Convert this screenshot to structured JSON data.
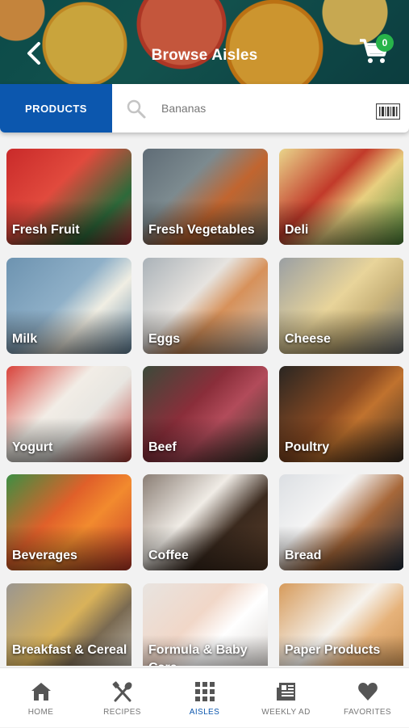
{
  "header": {
    "title": "Browse Aisles",
    "cart_count": "0"
  },
  "search": {
    "tab_label": "PRODUCTS",
    "value": "Bananas"
  },
  "aisles": [
    {
      "label": "Fresh Fruit",
      "bg": "linear-gradient(135deg,#c92a2a,#e14a3d 40%,#2d6a3a 75%,#b8323a)"
    },
    {
      "label": "Fresh Vegetables",
      "bg": "linear-gradient(135deg,#5f6c76,#7c8a8f 35%,#c1652f 60%,#6a6a5a)"
    },
    {
      "label": "Deli",
      "bg": "linear-gradient(135deg,#e9d58b,#c23a2a 40%,#e8cf7f 60%,#4f8a3a)"
    },
    {
      "label": "Milk",
      "bg": "linear-gradient(135deg,#6d93b0,#8fb0c8 45%,#f0eee3 65%,#6a8ea8)"
    },
    {
      "label": "Eggs",
      "bg": "linear-gradient(135deg,#aab2b8,#e6e3df 40%,#d7915a 60%,#cfcac2)"
    },
    {
      "label": "Cheese",
      "bg": "linear-gradient(135deg,#9a9fa3,#e8d49a 45%,#c9b37a 65%,#6f7478)"
    },
    {
      "label": "Yogurt",
      "bg": "linear-gradient(135deg,#d8423a,#f2ede6 40%,#e8e6e1 60%,#b93a33)"
    },
    {
      "label": "Beef",
      "bg": "linear-gradient(135deg,#3c4a3a,#8a2e3a 40%,#b24b5a 60%,#2f3a2a)"
    },
    {
      "label": "Poultry",
      "bg": "linear-gradient(135deg,#2a2622,#8a4a22 45%,#c0722e 60%,#3a2e24)"
    },
    {
      "label": "Beverages",
      "bg": "linear-gradient(135deg,#3d8f43,#e0602a 40%,#f28a2e 60%,#c63a2a)"
    },
    {
      "label": "Coffee",
      "bg": "linear-gradient(135deg,#8a7e74,#f0ece6 40%,#3b2a1e 65%,#5a3e2a)"
    },
    {
      "label": "Bread",
      "bg": "linear-gradient(135deg,#dcdfe3,#f4f4f4 35%,#a7683a 60%,#1f2d3e)"
    },
    {
      "label": "Breakfast & Cereal",
      "bg": "linear-gradient(135deg,#9a9690,#d9b25a 45%,#7a6a52 65%,#c8c4bc)"
    },
    {
      "label": "Formula & Baby Care",
      "bg": "linear-gradient(135deg,#e8e4e0,#f1d7c8 40%,#ffffff 60%,#d8d3cf)"
    },
    {
      "label": "Paper Products",
      "bg": "linear-gradient(135deg,#d69a5a,#f6f3ee 45%,#e6b27a 65%,#c48a4a)"
    }
  ],
  "tabs": [
    {
      "label": "HOME",
      "icon": "home-icon"
    },
    {
      "label": "RECIPES",
      "icon": "utensils-icon"
    },
    {
      "label": "AISLES",
      "icon": "grid-icon"
    },
    {
      "label": "WEEKLY AD",
      "icon": "newspaper-icon"
    },
    {
      "label": "FAVORITES",
      "icon": "heart-icon"
    }
  ],
  "colors": {
    "accent": "#0c57ae",
    "badge": "#28b44a",
    "icon_gray": "#555555"
  }
}
